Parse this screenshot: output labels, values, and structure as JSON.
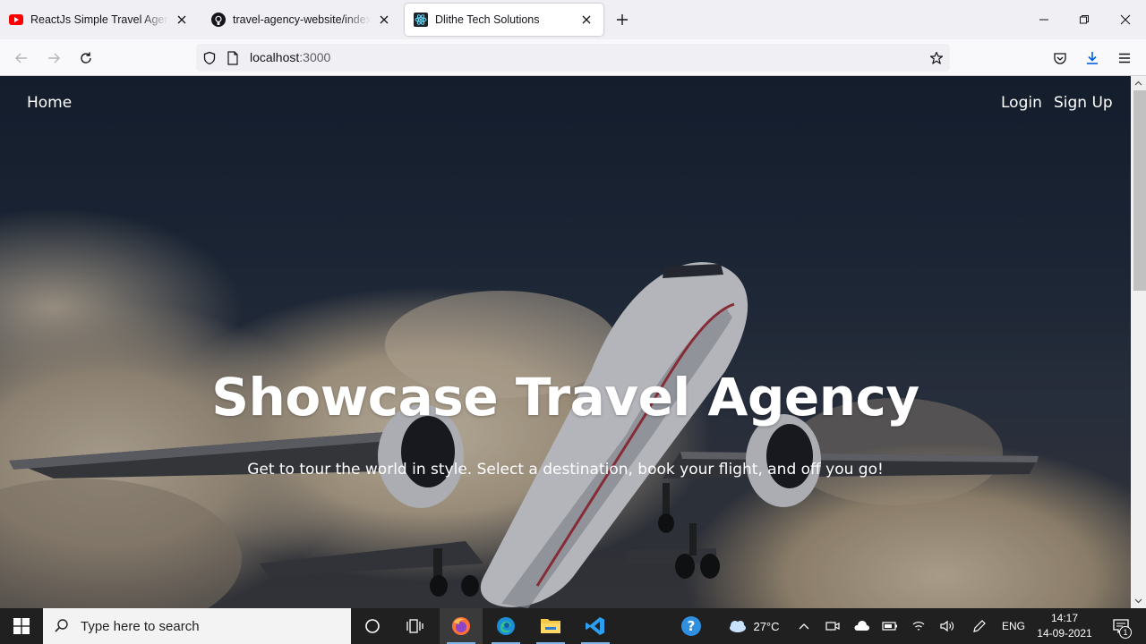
{
  "browser": {
    "tabs": [
      {
        "label": "ReactJs Simple Travel Agency La",
        "icon": "youtube-icon",
        "active": false
      },
      {
        "label": "travel-agency-website/index.css",
        "icon": "github-icon",
        "active": false
      },
      {
        "label": "Dlithe Tech Solutions",
        "icon": "react-icon",
        "active": true
      }
    ],
    "url": {
      "host": "localhost",
      "port": ":3000"
    }
  },
  "site": {
    "nav": {
      "home": "Home",
      "login": "Login",
      "signup": "Sign Up"
    },
    "hero": {
      "title": "Showcase Travel Agency",
      "subtitle": "Get to tour the world in style. Select a destination, book your flight, and off you go!"
    }
  },
  "taskbar": {
    "search_placeholder": "Type here to search",
    "weather": "27°C",
    "language": "ENG",
    "time": "14:17",
    "date": "14-09-2021",
    "notification_count": "1"
  },
  "colors": {
    "taskbar": "#202020",
    "accent": "#0078d4",
    "youtube_red": "#ff0000"
  }
}
